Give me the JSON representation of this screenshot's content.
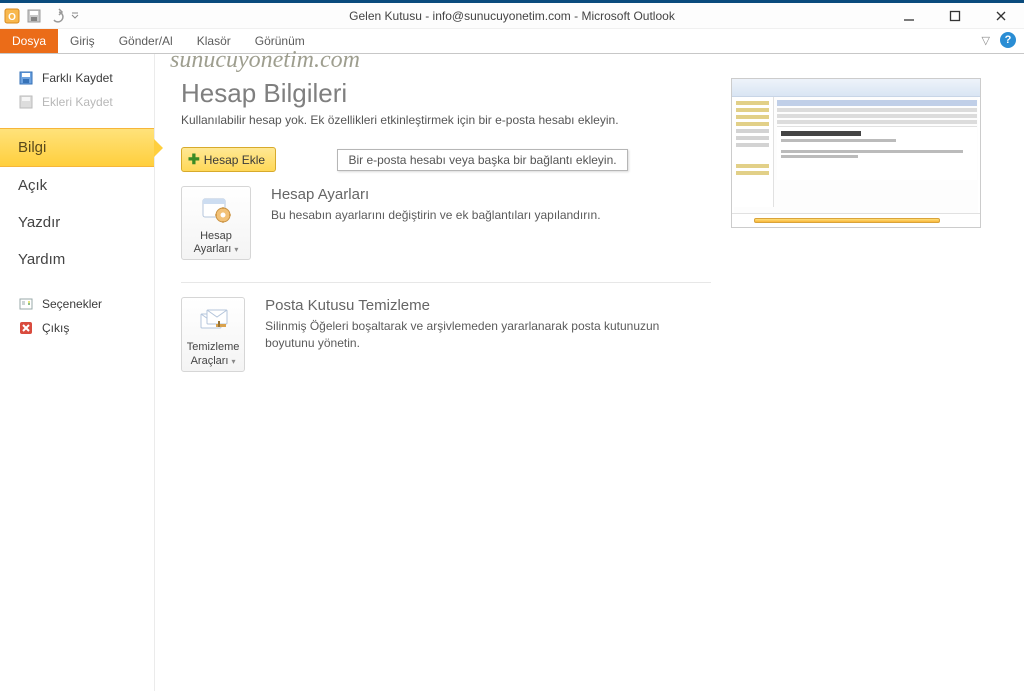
{
  "window": {
    "title": "Gelen Kutusu - info@sunucuyonetim.com  -  Microsoft Outlook"
  },
  "watermark": "sunucuyonetim.com",
  "tabs": {
    "file": "Dosya",
    "home": "Giriş",
    "sendreceive": "Gönder/Al",
    "folder": "Klasör",
    "view": "Görünüm"
  },
  "sidebar": {
    "saveAs": "Farklı Kaydet",
    "saveAttachments": "Ekleri Kaydet",
    "info": "Bilgi",
    "open": "Açık",
    "print": "Yazdır",
    "help": "Yardım",
    "options": "Seçenekler",
    "exit": "Çıkış"
  },
  "content": {
    "heading": "Hesap Bilgileri",
    "subtext": "Kullanılabilir hesap yok. Ek özellikleri etkinleştirmek için bir e-posta hesabı ekleyin.",
    "addAccount": "Hesap Ekle",
    "tooltip": "Bir e-posta hesabı veya başka bir bağlantı ekleyin.",
    "sec1": {
      "btn": "Hesap Ayarları",
      "title": "Hesap Ayarları",
      "desc": "Bu hesabın ayarlarını değiştirin ve ek bağlantıları yapılandırın."
    },
    "sec2": {
      "btn": "Temizleme Araçları",
      "title": "Posta Kutusu Temizleme",
      "desc": "Silinmiş Öğeleri boşaltarak ve arşivlemeden yararlanarak posta kutunuzun boyutunu yönetin."
    }
  }
}
